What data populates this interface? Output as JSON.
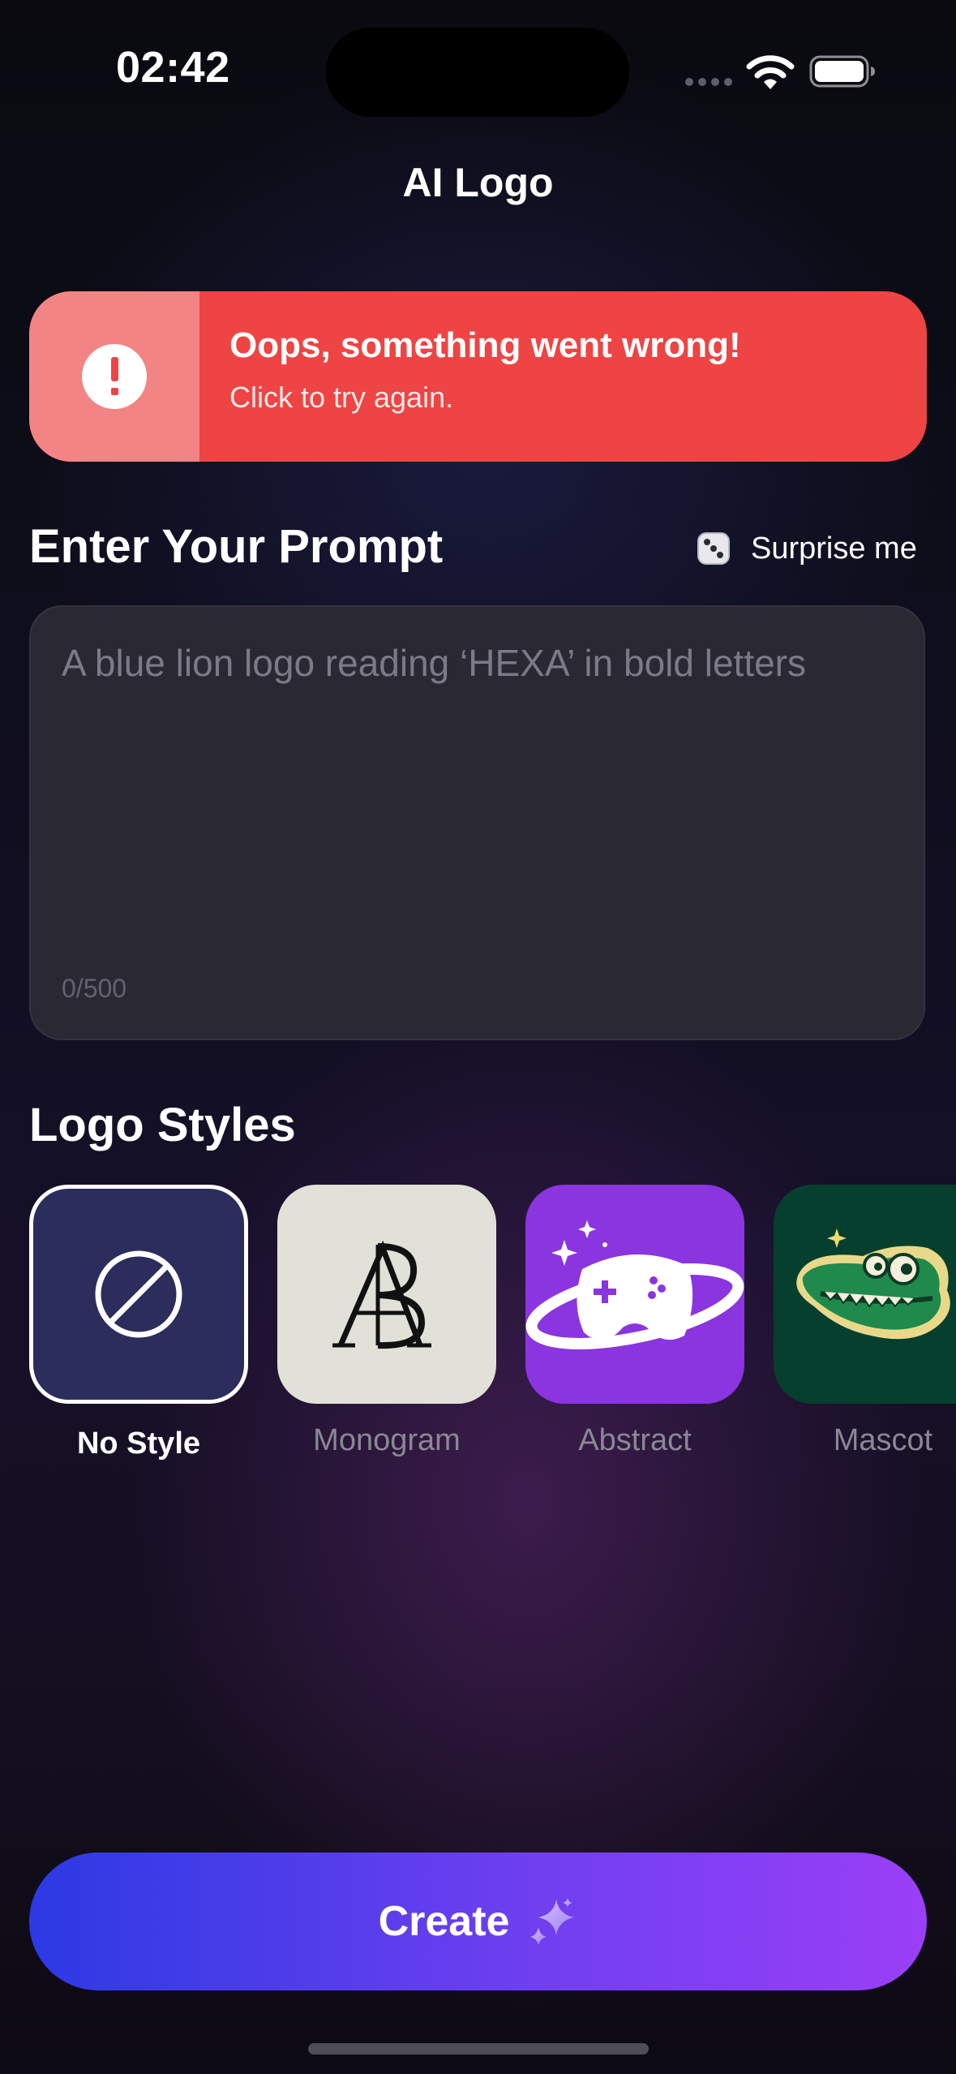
{
  "status_bar": {
    "time": "02:42",
    "wifi_icon": "wifi-icon",
    "battery_icon": "battery-full-icon"
  },
  "header": {
    "title": "AI Logo"
  },
  "error_banner": {
    "icon": "exclamation-icon",
    "title": "Oops, something went wrong!",
    "subtitle": "Click to try again.",
    "color": "#ef4444",
    "icon_panel_color": "#f38484"
  },
  "prompt": {
    "heading": "Enter Your Prompt",
    "surprise_icon": "dice-icon",
    "surprise_label": "Surprise me",
    "placeholder": "A blue lion logo reading ‘HEXA’ in bold letters",
    "value": "",
    "counter": "0/500"
  },
  "logo_styles": {
    "heading": "Logo Styles",
    "items": [
      {
        "label": "No Style",
        "icon": "no-style-icon",
        "selected": true
      },
      {
        "label": "Monogram",
        "icon": "monogram-logo",
        "selected": false
      },
      {
        "label": "Abstract",
        "icon": "planet-controller-logo",
        "selected": false
      },
      {
        "label": "Mascot",
        "icon": "crocodile-mascot-logo",
        "selected": false
      }
    ]
  },
  "create_button": {
    "label": "Create",
    "icon": "sparkle-icon",
    "gradient": [
      "#2c3ae3",
      "#9a3ff7"
    ]
  }
}
